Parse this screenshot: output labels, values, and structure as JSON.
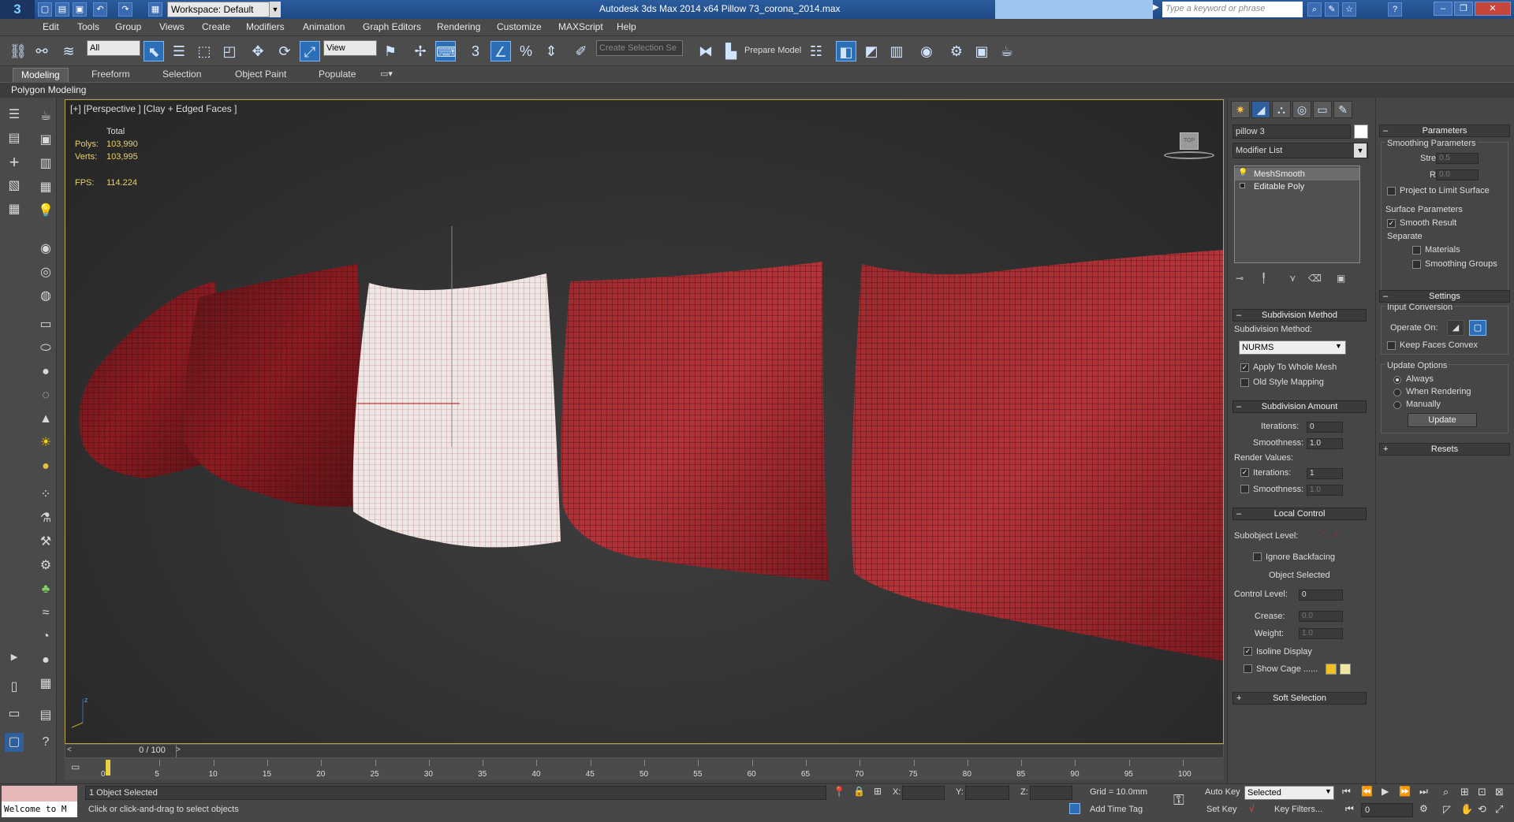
{
  "window": {
    "title": "Autodesk 3ds Max  2014 x64      Pillow 73_corona_2014.max",
    "workspace": "Workspace: Default",
    "search_placeholder": "Type a keyword or phrase"
  },
  "menu": [
    "Edit",
    "Tools",
    "Group",
    "Views",
    "Create",
    "Modifiers",
    "Animation",
    "Graph Editors",
    "Rendering",
    "Customize",
    "MAXScript",
    "Help"
  ],
  "toolbar": {
    "filter_value": "All",
    "refcoord_value": "View",
    "selection_set_value": "Create Selection Se",
    "prepare_model_label": "Prepare Model",
    "snaps": [
      "3",
      "%"
    ]
  },
  "ribbon": {
    "tabs": [
      "Modeling",
      "Freeform",
      "Selection",
      "Object Paint",
      "Populate"
    ],
    "active_tab": "Modeling",
    "panel_label": "Polygon Modeling"
  },
  "viewport": {
    "label": "[+] [Perspective ] [Clay + Edged Faces ]",
    "stats": {
      "total_label": "Total",
      "polys_label": "Polys:",
      "polys_value": "103,990",
      "verts_label": "Verts:",
      "verts_value": "103,995",
      "fps_label": "FPS:",
      "fps_value": "114.224"
    },
    "viewcube_label": "TOP",
    "axis_label": "z"
  },
  "timeline": {
    "frame_readout": "0 / 100",
    "ticks": [
      "0",
      "5",
      "10",
      "15",
      "20",
      "25",
      "30",
      "35",
      "40",
      "45",
      "50",
      "55",
      "60",
      "65",
      "70",
      "75",
      "80",
      "85",
      "90",
      "95",
      "100"
    ]
  },
  "status": {
    "maxscript_listener": "Welcome to M",
    "selection_status": "1 Object Selected",
    "prompt": "Click or click-and-drag to select objects",
    "x_label": "X:",
    "y_label": "Y:",
    "z_label": "Z:",
    "grid": "Grid = 10.0mm",
    "add_time_tag": "Add Time Tag",
    "auto_key": "Auto Key",
    "set_key": "Set Key",
    "key_mode_value": "Selected",
    "key_filters": "Key Filters...",
    "current_frame": "0"
  },
  "command_panel": {
    "object_name": "pillow 3",
    "modifier_list": "Modifier List",
    "stack": [
      "MeshSmooth",
      "Editable Poly"
    ],
    "subdivision_method": {
      "header": "Subdivision Method",
      "label": "Subdivision Method:",
      "value": "NURMS",
      "apply_whole_mesh": "Apply To Whole Mesh",
      "old_style_mapping": "Old Style Mapping"
    },
    "subdivision_amount": {
      "header": "Subdivision Amount",
      "iterations_label": "Iterations:",
      "iterations_value": "0",
      "smoothness_label": "Smoothness:",
      "smoothness_value": "1.0",
      "render_values_label": "Render Values:",
      "render_iterations_label": "Iterations:",
      "render_iterations_value": "1",
      "render_smoothness_label": "Smoothness:",
      "render_smoothness_value": "1.0"
    },
    "local_control": {
      "header": "Local Control",
      "subobject_label": "Subobject Level:",
      "ignore_backfacing": "Ignore Backfacing",
      "object_selected": "Object Selected",
      "control_level_label": "Control Level:",
      "control_level_value": "0",
      "crease_label": "Crease:",
      "crease_value": "0.0",
      "weight_label": "Weight:",
      "weight_value": "1.0",
      "isoline_display": "Isoline Display",
      "show_cage": "Show Cage ......"
    },
    "soft_selection": "Soft Selection"
  },
  "right_panel": {
    "parameters": {
      "header": "Parameters",
      "smoothing_params": "Smoothing Parameters",
      "strength_label": "Strength:",
      "strength_value": "0.5",
      "relax_label": "Relax:",
      "relax_value": "0.0",
      "project_limit": "Project to Limit Surface",
      "surface_params": "Surface Parameters",
      "smooth_result": "Smooth Result",
      "separate": "Separate",
      "materials": "Materials",
      "smoothing_groups": "Smoothing Groups"
    },
    "settings": {
      "header": "Settings",
      "input_conversion": "Input Conversion",
      "operate_on": "Operate On:",
      "keep_faces_convex": "Keep Faces Convex",
      "update_options": "Update Options",
      "always": "Always",
      "when_rendering": "When Rendering",
      "manually": "Manually",
      "update_button": "Update"
    },
    "resets": "Resets"
  },
  "colors": {
    "pillow_red": "#8a1c22",
    "pillow_selected": "#f2eaea",
    "accent_blue": "#2d6fb6",
    "cage_yellow": "#f0c020",
    "cage_light": "#f0e8a0"
  }
}
